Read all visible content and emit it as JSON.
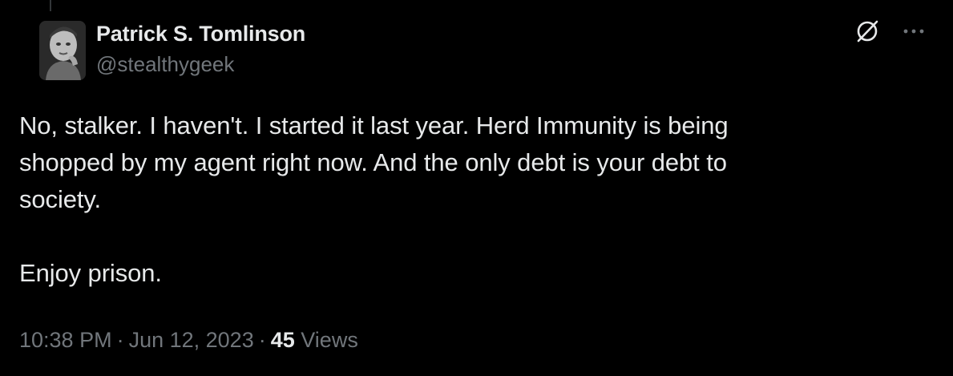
{
  "tweet": {
    "author": {
      "display_name": "Patrick S. Tomlinson",
      "handle": "@stealthygeek"
    },
    "text_lines": [
      "No, stalker. I haven't. I started it last year. Herd Immunity is being",
      "shopped by my agent right now. And the only debt is your debt to",
      "society."
    ],
    "text_line_last": "Enjoy prison.",
    "time": "10:38 PM",
    "separator": "·",
    "date": "Jun 12, 2023",
    "views_count": "45",
    "views_label": "Views"
  },
  "icons": {
    "grok": "grok-icon",
    "more": "more-icon"
  },
  "colors": {
    "background": "#000000",
    "primary_text": "#e7e9ea",
    "secondary_text": "#71767b"
  }
}
